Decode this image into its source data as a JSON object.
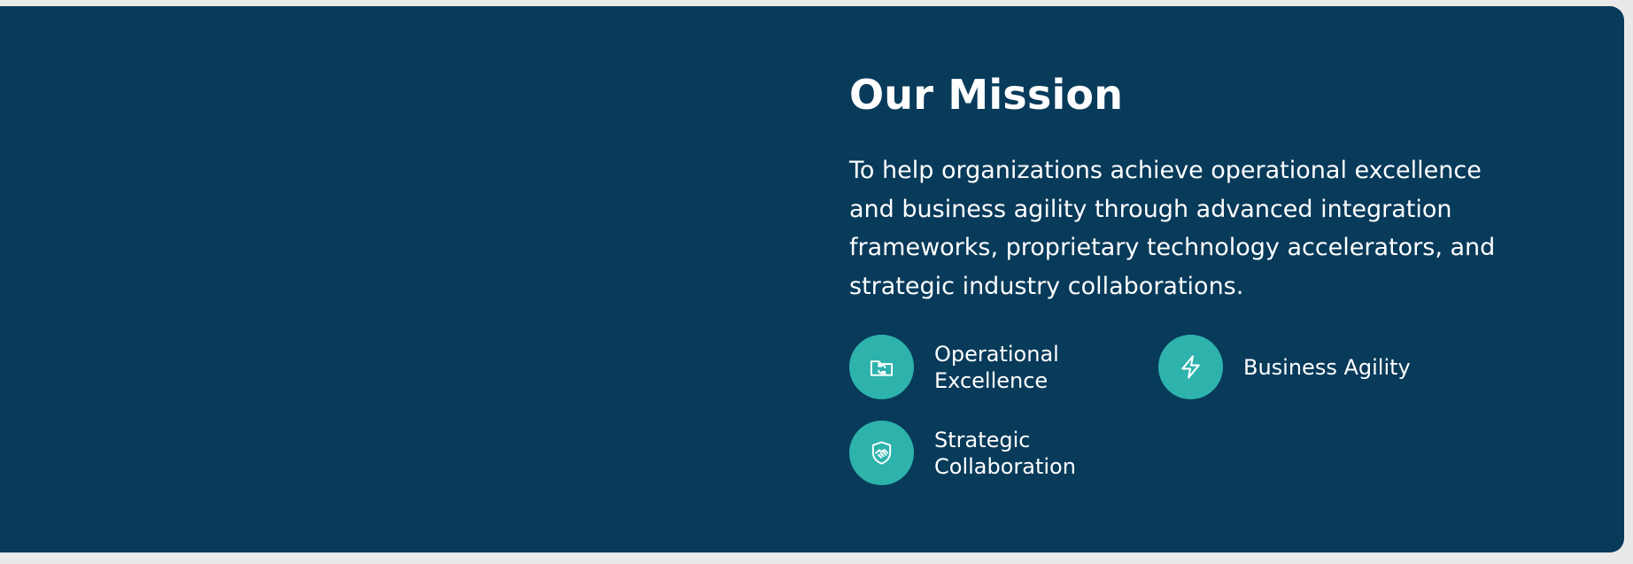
{
  "mission": {
    "title": "Our Mission",
    "description": "To help organizations achieve operational excellence and business agility through advanced integration frameworks, proprietary technology accelerators, and strategic industry collaborations.",
    "features": [
      {
        "label": "Operational Excellence",
        "icon": "folder-sync-icon"
      },
      {
        "label": "Business Agility",
        "icon": "lightning-bolt-icon"
      },
      {
        "label": "Strategic Collaboration",
        "icon": "handshake-shield-icon"
      }
    ]
  },
  "colors": {
    "section_background": "#083a5a",
    "accent": "#2db3ac",
    "text": "#ffffff"
  }
}
